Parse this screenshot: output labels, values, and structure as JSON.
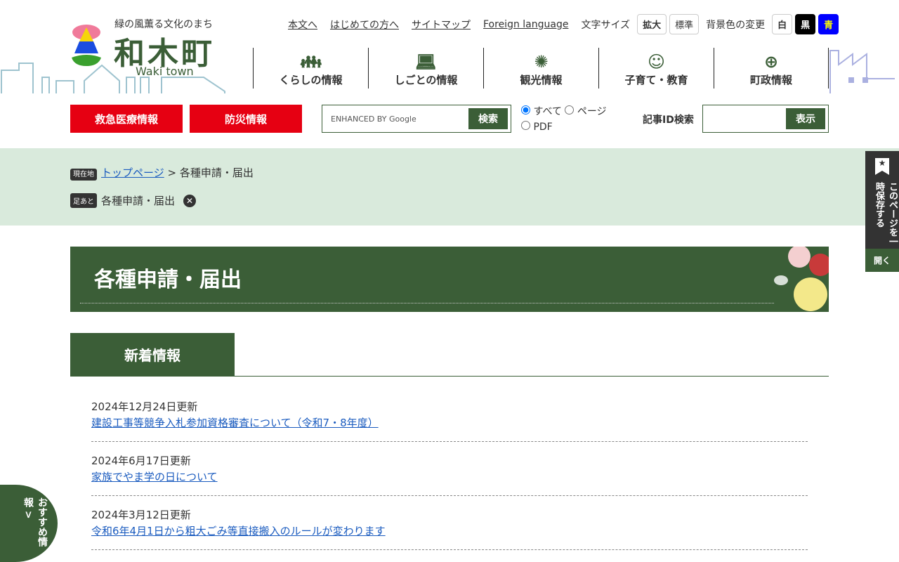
{
  "header": {
    "tagline": "緑の風薫る文化のまち",
    "title": "和木町",
    "subtitle": "Waki town",
    "links": [
      "本文へ",
      "はじめての方へ",
      "サイトマップ",
      "Foreign language"
    ],
    "font_size_label": "文字サイズ",
    "font_enlarge": "拡大",
    "font_standard": "標準",
    "bg_label": "背景色の変更",
    "bg_white": "白",
    "bg_black": "黒",
    "bg_blue": "青"
  },
  "nav": [
    {
      "label": "くらしの情報",
      "icon": "family-icon"
    },
    {
      "label": "しごとの情報",
      "icon": "worker-icon"
    },
    {
      "label": "観光情報",
      "icon": "fireworks-icon"
    },
    {
      "label": "子育て・教育",
      "icon": "child-face-icon"
    },
    {
      "label": "町政情報",
      "icon": "town-emblem-icon"
    }
  ],
  "emergency": "救急医療情報",
  "disaster": "防災情報",
  "search": {
    "placeholder": "ENHANCED BY Google",
    "button": "検索",
    "options": [
      "すべて",
      "ページ",
      "PDF"
    ],
    "id_label": "記事ID検索",
    "id_button": "表示"
  },
  "breadcrumb": {
    "current_badge": "現在地",
    "home": "トップページ",
    "sep": " > ",
    "current": "各種申請・届出",
    "history_badge": "足あと",
    "history_item": "各種申請・届出"
  },
  "page_title": "各種申請・届出",
  "tab": "新着情報",
  "news": [
    {
      "date": "2024年12月24日更新",
      "title": "建設工事等競争入札参加資格審査について（令和7・8年度）"
    },
    {
      "date": "2024年6月17日更新",
      "title": "家族でやま学の日について"
    },
    {
      "date": "2024年3月12日更新",
      "title": "令和6年4月1日から粗大ごみ等直接搬入のルールが変わります"
    }
  ],
  "side": {
    "label": "このページを一時保存する",
    "open": "開く"
  },
  "recommend": "おすすめ情報 >",
  "colors": {
    "green": "#3b5e37",
    "red": "#e60012",
    "light_green": "#d9eadc"
  }
}
